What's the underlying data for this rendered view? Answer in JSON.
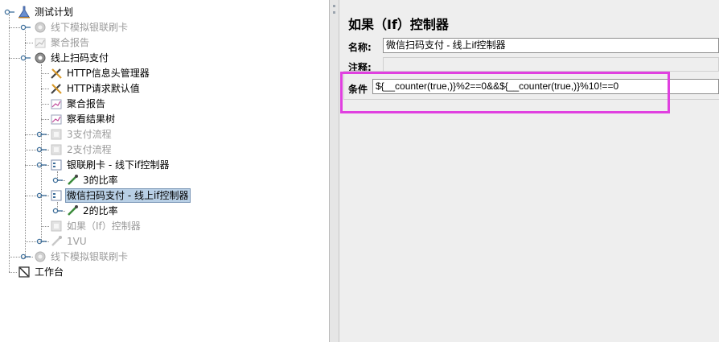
{
  "tree": {
    "nodes": [
      {
        "label": "测试计划",
        "icon": "test-plan-icon",
        "disabled": false
      },
      {
        "label": "线下模拟银联刷卡",
        "icon": "thread-group-icon",
        "disabled": true
      },
      {
        "label": "聚合报告",
        "icon": "aggregate-report-icon",
        "disabled": true
      },
      {
        "label": "线上扫码支付",
        "icon": "thread-group-icon",
        "disabled": false
      },
      {
        "label": "HTTP信息头管理器",
        "icon": "wrench-icon",
        "disabled": false
      },
      {
        "label": "HTTP请求默认值",
        "icon": "wrench-icon",
        "disabled": false
      },
      {
        "label": "聚合报告",
        "icon": "aggregate-report-icon",
        "disabled": false
      },
      {
        "label": "察看结果树",
        "icon": "result-tree-icon",
        "disabled": false
      },
      {
        "label": "3支付流程",
        "icon": "controller-icon",
        "disabled": true
      },
      {
        "label": "2支付流程",
        "icon": "controller-icon",
        "disabled": true
      },
      {
        "label": "银联刷卡 - 线下if控制器",
        "icon": "if-controller-icon",
        "disabled": false
      },
      {
        "label": "3的比率",
        "icon": "throughput-icon",
        "disabled": false
      },
      {
        "label": "微信扫码支付 - 线上if控制器",
        "icon": "if-controller-icon",
        "disabled": false,
        "selected": true
      },
      {
        "label": "2的比率",
        "icon": "throughput-icon",
        "disabled": false
      },
      {
        "label": "如果（If）控制器",
        "icon": "controller-icon",
        "disabled": true
      },
      {
        "label": "1VU",
        "icon": "throughput-icon",
        "disabled": true
      },
      {
        "label": "线下模拟银联刷卡",
        "icon": "thread-group-icon",
        "disabled": true
      },
      {
        "label": "工作台",
        "icon": "workbench-icon",
        "disabled": false
      }
    ]
  },
  "panel": {
    "title": "如果（If）控制器",
    "name_label": "名称:",
    "name_value": "微信扫码支付 - 线上if控制器",
    "comment_label": "注释:",
    "comment_value": "",
    "condition_label": "条件",
    "condition_value": "${__counter(true,)}%2==0&&${__counter(true,)}%10!==0"
  },
  "colors": {
    "highlight": "#e040e0",
    "selection": "#b8cfe5",
    "disabled_text": "#9a9a9a"
  }
}
